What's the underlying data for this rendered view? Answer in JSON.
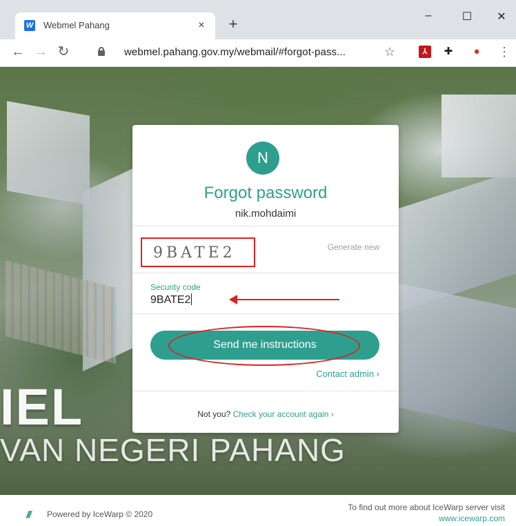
{
  "browser": {
    "tab_title": "Webmel Pahang",
    "tab_favicon": "W",
    "tab_close": "×",
    "new_tab": "+",
    "url": "webmel.pahang.gov.my/webmail/#forgot-pass...",
    "icons": [
      "back-arrow",
      "forward-arrow",
      "reload",
      "lock",
      "star",
      "pdf-extension",
      "puzzle-extension",
      "red-extension",
      "menu-dots"
    ],
    "window_controls": {
      "minimize": "–",
      "maximize": "☐",
      "close": "✕"
    }
  },
  "background": {
    "brand_line1": "IEL",
    "brand_line2": "VAN NEGERI PAHANG"
  },
  "card": {
    "avatar_letter": "N",
    "title": "Forgot password",
    "username": "nik.mohdaimi",
    "captcha": "9BATE2",
    "generate_new": "Generate new",
    "security_label": "Security code",
    "security_value": "9BATE2",
    "send_button": "Send me instructions",
    "contact_admin": "Contact admin ›",
    "not_you": "Not you?",
    "check_again": "Check your account again ›"
  },
  "annotations": {
    "color": "#e02020"
  },
  "colors": {
    "accent": "#2e9f8f"
  },
  "footer": {
    "logo": "W",
    "powered": "Powered by IceWarp © 2020",
    "find_more": "To find out more about IceWarp server visit",
    "link": "www.icewarp.com"
  }
}
